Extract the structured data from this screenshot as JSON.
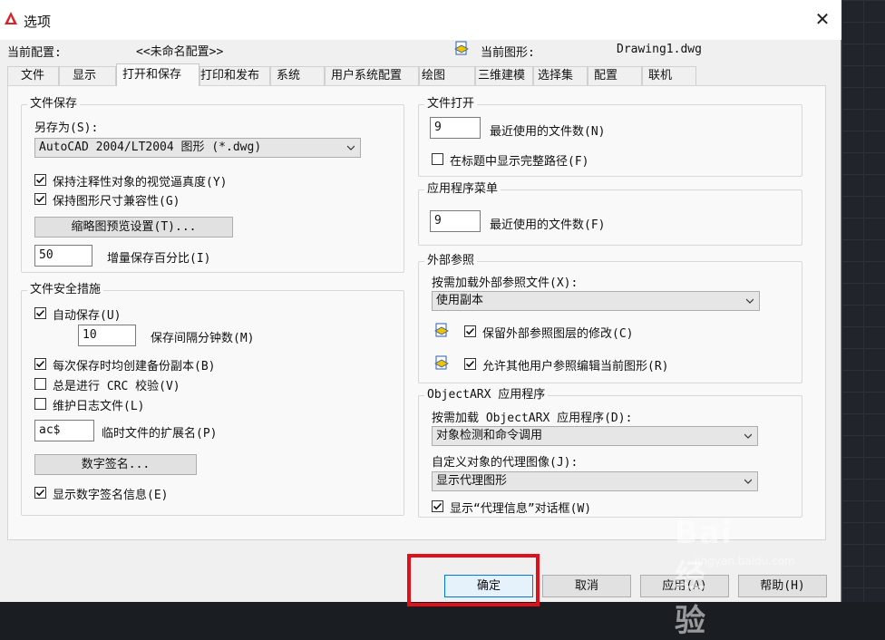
{
  "window": {
    "title": "选项"
  },
  "header": {
    "profile_label": "当前配置:",
    "profile_value": "<<未命名配置>>",
    "drawing_label": "当前图形:",
    "drawing_value": "Drawing1.dwg"
  },
  "tabs": [
    {
      "label": "文件"
    },
    {
      "label": "显示"
    },
    {
      "label": "打开和保存"
    },
    {
      "label": "打印和发布"
    },
    {
      "label": "系统"
    },
    {
      "label": "用户系统配置"
    },
    {
      "label": "绘图"
    },
    {
      "label": "三维建模"
    },
    {
      "label": "选择集"
    },
    {
      "label": "配置"
    },
    {
      "label": "联机"
    }
  ],
  "file_save": {
    "title": "文件保存",
    "save_as_label": "另存为(S):",
    "save_as_value": "AutoCAD 2004/LT2004 图形 (*.dwg)",
    "maintain_visual_fidelity": "保持注释性对象的视觉逼真度(Y)",
    "maintain_drawing_size": "保持图形尺寸兼容性(G)",
    "thumbnail_button": "缩略图预览设置(T)...",
    "incremental_value": "50",
    "incremental_label": "增量保存百分比(I)"
  },
  "file_safety": {
    "title": "文件安全措施",
    "autosave": "自动保存(U)",
    "interval_value": "10",
    "interval_label": "保存间隔分钟数(M)",
    "backup": "每次保存时均创建备份副本(B)",
    "crc": "总是进行 CRC 校验(V)",
    "log": "维护日志文件(L)",
    "temp_ext_value": "ac$",
    "temp_ext_label": "临时文件的扩展名(P)",
    "digital_sig_button": "数字签名...",
    "show_sig_info": "显示数字签名信息(E)"
  },
  "file_open": {
    "title": "文件打开",
    "recent_value": "9",
    "recent_label": "最近使用的文件数(N)",
    "full_path": "在标题中显示完整路径(F)"
  },
  "app_menu": {
    "title": "应用程序菜单",
    "recent_value": "9",
    "recent_label": "最近使用的文件数(F)"
  },
  "xref": {
    "title": "外部参照",
    "demand_load_label": "按需加载外部参照文件(X):",
    "demand_load_value": "使用副本",
    "retain_changes": "保留外部参照图层的修改(C)",
    "allow_edit": "允许其他用户参照编辑当前图形(R)"
  },
  "objectarx": {
    "title": "ObjectARX 应用程序",
    "demand_load_label": "按需加载 ObjectARX 应用程序(D):",
    "demand_load_value": "对象检测和命令调用",
    "proxy_label": "自定义对象的代理图像(J):",
    "proxy_value": "显示代理图形",
    "show_proxy_dialog": "显示“代理信息”对话框(W)"
  },
  "buttons": {
    "ok": "确定",
    "cancel": "取消",
    "apply": "应用(A)",
    "help": "帮助(H)"
  },
  "watermark": {
    "main": "Bai 经验",
    "sub": "jingyan.baidu.com"
  },
  "colors": {
    "accent": "#0078d7",
    "highlight": "#e0101a",
    "title_icon": "#d8232a"
  }
}
